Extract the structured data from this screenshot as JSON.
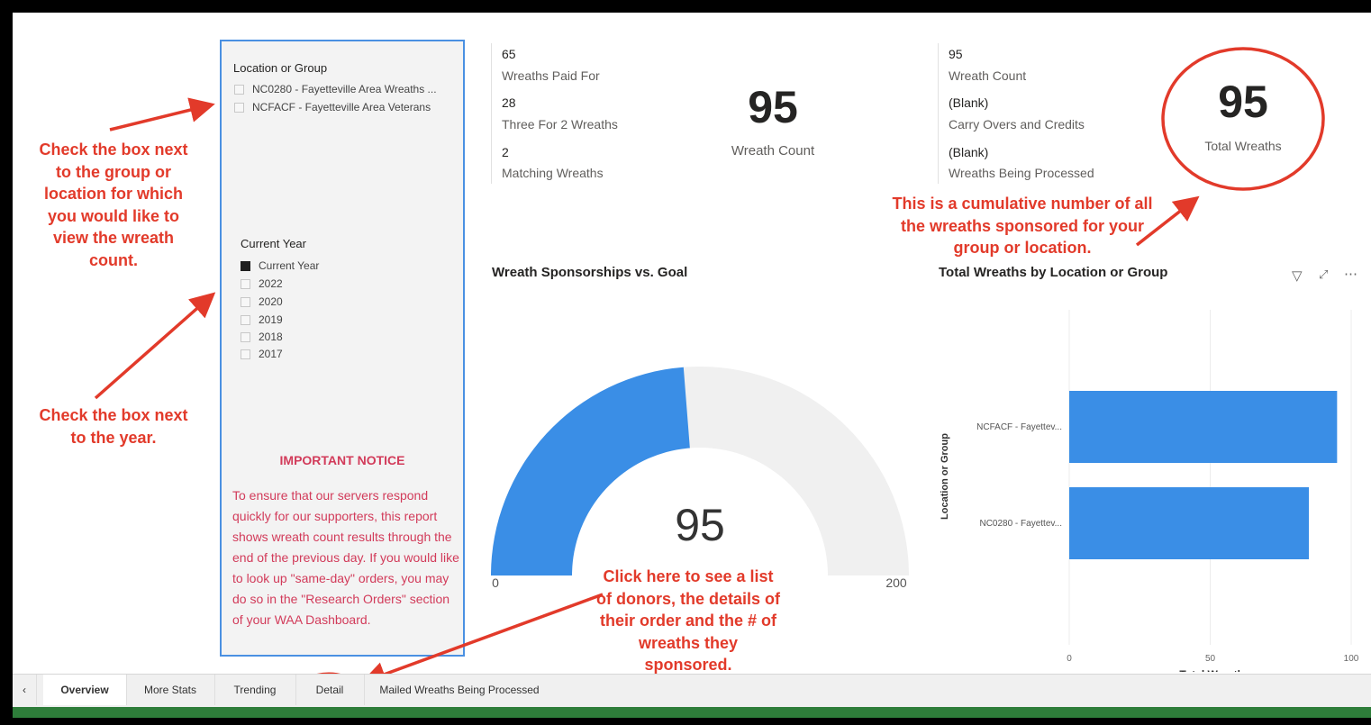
{
  "slicers": {
    "location": {
      "title": "Location or Group",
      "items": [
        {
          "label": "NC0280 - Fayetteville Area Wreaths ...",
          "checked": false
        },
        {
          "label": "NCFACF - Fayetteville Area Veterans",
          "checked": false
        }
      ]
    },
    "year": {
      "title": "Current Year",
      "items": [
        {
          "label": "Current Year",
          "checked": true
        },
        {
          "label": "2022",
          "checked": false
        },
        {
          "label": "2020",
          "checked": false
        },
        {
          "label": "2019",
          "checked": false
        },
        {
          "label": "2018",
          "checked": false
        },
        {
          "label": "2017",
          "checked": false
        }
      ]
    }
  },
  "notice": {
    "heading": "IMPORTANT NOTICE",
    "body": "To ensure that our servers respond quickly for our supporters, this report shows wreath count results through the end of the previous day. If you would like to look up \"same-day\" orders, you may do so in the \"Research Orders\" section of your WAA Dashboard."
  },
  "multi_card_left": [
    {
      "value": "65",
      "label": "Wreaths Paid For"
    },
    {
      "value": "28",
      "label": "Three For 2 Wreaths"
    },
    {
      "value": "2",
      "label": "Matching Wreaths"
    }
  ],
  "wreath_count_card": {
    "value": "95",
    "label": "Wreath Count"
  },
  "multi_card_right": [
    {
      "value": "95",
      "label": "Wreath Count"
    },
    {
      "value": "(Blank)",
      "label": "Carry Overs and Credits"
    },
    {
      "value": "(Blank)",
      "label": "Wreaths Being Processed"
    }
  ],
  "total_card": {
    "value": "95",
    "label": "Total Wreaths"
  },
  "gauge": {
    "title": "Wreath Sponsorships vs. Goal",
    "value": 95,
    "min": 0,
    "max": 200,
    "value_label": "95",
    "min_label": "0",
    "max_label": "200",
    "fill_color": "#3a8ee6",
    "track_color": "#f0f0f0"
  },
  "chart_data": {
    "type": "bar",
    "title": "Total Wreaths by Location or Group",
    "orientation": "horizontal",
    "categories": [
      "NCFACF - Fayettev...",
      "NC0280 - Fayettev..."
    ],
    "values": [
      95,
      85
    ],
    "xlabel": "Total Wreaths",
    "ylabel": "Location or Group",
    "xlim": [
      0,
      100
    ],
    "xticks": [
      "0",
      "50",
      "100"
    ],
    "grid": true,
    "color": "#3a8ee6"
  },
  "annotations": {
    "check_group": "Check the box next to the group or location for which you would like to view the wreath count.",
    "check_year": "Check the box next to the year.",
    "cumulative": "This is a cumulative number of all the wreaths sponsored for your group or location.",
    "click_detail": "Click here to see a list of donors, the details of their order and the # of wreaths they sponsored.",
    "color": "#e23a2a"
  },
  "tabs": [
    {
      "label": "Overview",
      "active": true
    },
    {
      "label": "More Stats",
      "active": false
    },
    {
      "label": "Trending",
      "active": false
    },
    {
      "label": "Detail",
      "active": false
    },
    {
      "label": "Mailed Wreaths Being Processed",
      "active": false
    }
  ],
  "chart_icons": [
    "filter-icon",
    "focus-mode-icon",
    "more-options-icon"
  ]
}
